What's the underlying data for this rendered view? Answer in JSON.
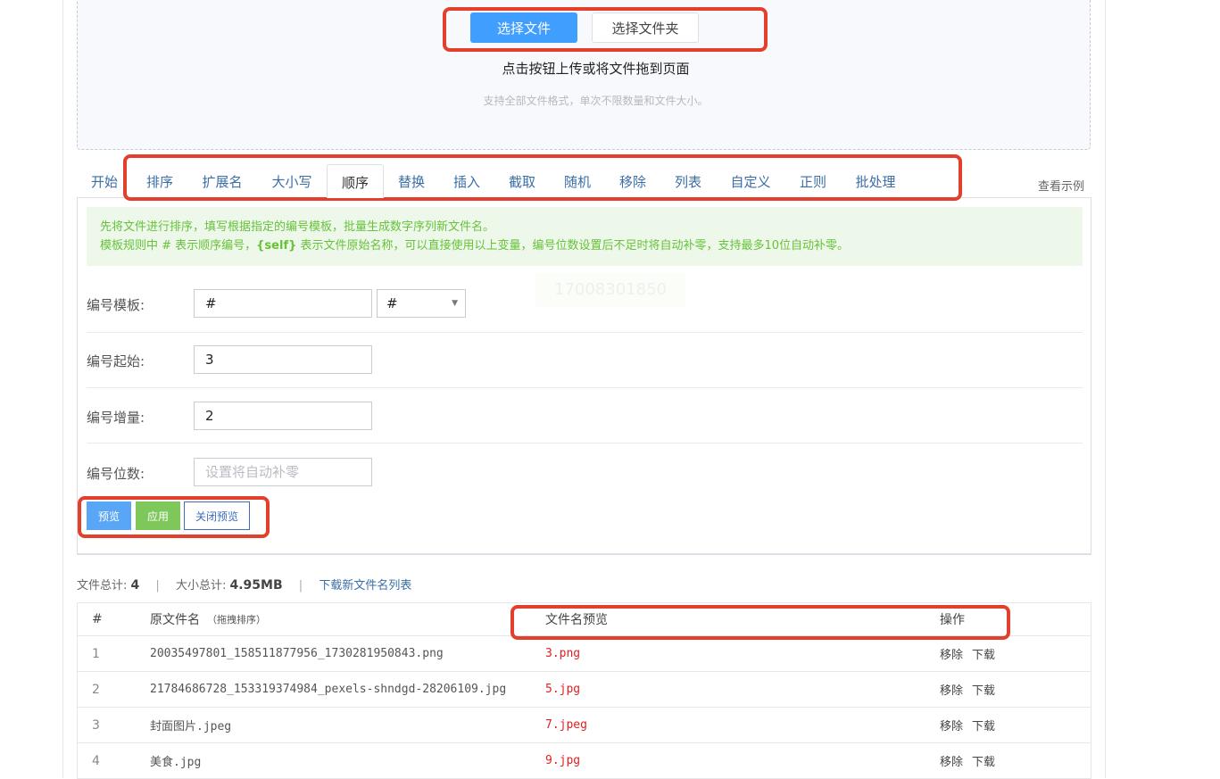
{
  "upload": {
    "select_file": "选择文件",
    "select_folder": "选择文件夹",
    "hint": "点击按钮上传或将文件拖到页面",
    "sub_hint": "支持全部文件格式，单次不限数量和文件大小。"
  },
  "tabs": [
    {
      "label": "开始"
    },
    {
      "label": "排序"
    },
    {
      "label": "扩展名"
    },
    {
      "label": "大小写"
    },
    {
      "label": "顺序",
      "active": true
    },
    {
      "label": "替换"
    },
    {
      "label": "插入"
    },
    {
      "label": "截取"
    },
    {
      "label": "随机"
    },
    {
      "label": "移除"
    },
    {
      "label": "列表"
    },
    {
      "label": "自定义"
    },
    {
      "label": "正则"
    },
    {
      "label": "批处理"
    }
  ],
  "see_example": "查看示例",
  "notice": {
    "line1": "先将文件进行排序，填写根据指定的编号模板，批量生成数字序列新文件名。",
    "line2_a": "模板规则中 # 表示顺序编号，",
    "line2_b": "{self}",
    "line2_c": " 表示文件原始名称，可以直接使用以上变量，编号位数设置后不足时将自动补零，支持最多10位自动补零。"
  },
  "watermark": "17008301850",
  "form": {
    "template_label": "编号模板:",
    "template_value": "#",
    "template_select": "#",
    "start_label": "编号起始:",
    "start_value": "3",
    "step_label": "编号增量:",
    "step_value": "2",
    "digits_label": "编号位数:",
    "digits_placeholder": "设置将自动补零"
  },
  "buttons": {
    "preview": "预览",
    "apply": "应用",
    "close_preview": "关闭预览"
  },
  "stats": {
    "count_label": "文件总计:",
    "count": "4",
    "size_label": "大小总计:",
    "size": "4.95MB",
    "download_list": "下载新文件名列表"
  },
  "table": {
    "headers": {
      "index": "#",
      "original": "原文件名",
      "original_note": "（拖拽排序）",
      "preview": "文件名预览",
      "actions": "操作"
    },
    "rows": [
      {
        "index": "1",
        "original": "20035497801_158511877956_1730281950843.png",
        "preview": "3.png",
        "remove": "移除",
        "download": "下载"
      },
      {
        "index": "2",
        "original": "21784686728_153319374984_pexels-shndgd-28206109.jpg",
        "preview": "5.jpg",
        "remove": "移除",
        "download": "下载"
      },
      {
        "index": "3",
        "original": "封面图片.jpeg",
        "preview": "7.jpeg",
        "remove": "移除",
        "download": "下载"
      },
      {
        "index": "4",
        "original": "美食.jpg",
        "preview": "9.jpg",
        "remove": "移除",
        "download": "下载"
      }
    ]
  },
  "colors": {
    "primary": "#409eff",
    "success": "#7dc75b",
    "highlight": "#e2402c",
    "link": "#3a6ea5",
    "preview_text": "#e02020"
  }
}
